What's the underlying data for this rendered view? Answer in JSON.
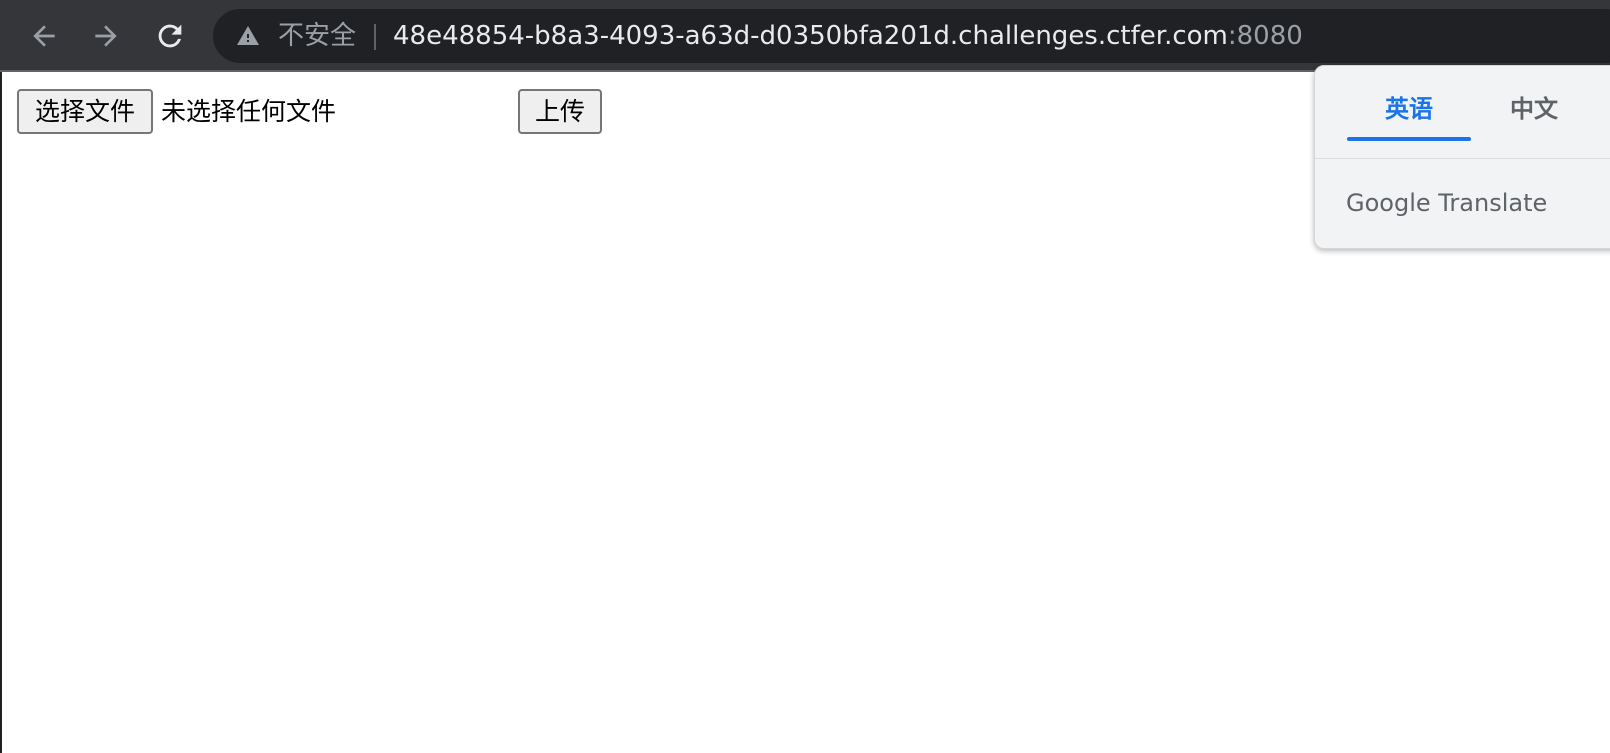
{
  "browser": {
    "security_label": "不安全",
    "url_host": "48e48854-b8a3-4093-a63d-d0350bfa201d.challenges.ctfer.com",
    "url_port": ":8080",
    "icons": {
      "back": "back-arrow-icon",
      "forward": "forward-arrow-icon",
      "reload": "reload-icon",
      "security": "warning-triangle-icon"
    }
  },
  "page": {
    "choose_file_label": "选择文件",
    "no_file_text": "未选择任何文件",
    "upload_label": "上传"
  },
  "translate_popup": {
    "source_lang": "英语",
    "target_lang": "中文",
    "logo_google": "Google",
    "logo_translate": "Translate",
    "active_color": "#1a73e8"
  }
}
